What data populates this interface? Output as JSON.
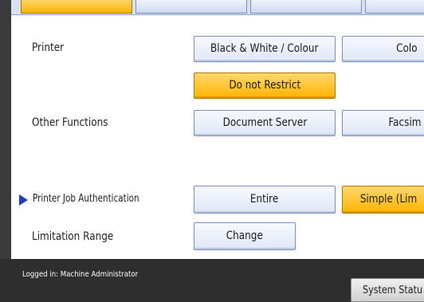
{
  "rows": {
    "printer": {
      "label": "Printer",
      "option_1": "Black & White / Colour",
      "option_2": "Colo",
      "selected": "Do not Restrict"
    },
    "other_functions": {
      "label": "Other Functions",
      "option_1": "Document Server",
      "option_2": "Facsim"
    },
    "printer_job_authentication": {
      "label": "Printer Job Authentication",
      "option_1": "Entire",
      "option_2": "Simple (Lim"
    },
    "limitation_range": {
      "label": "Limitation Range",
      "button": "Change"
    }
  },
  "status_bar": {
    "login_text": "Logged in: Machine Administrator",
    "system_status": "System Statu"
  },
  "colors": {
    "selected_bg": "#ffb400",
    "button_bg": "#e8eef9",
    "border": "#7b8fbb",
    "status_bg": "#2e2e2e",
    "arrow": "#1f3fbf"
  }
}
